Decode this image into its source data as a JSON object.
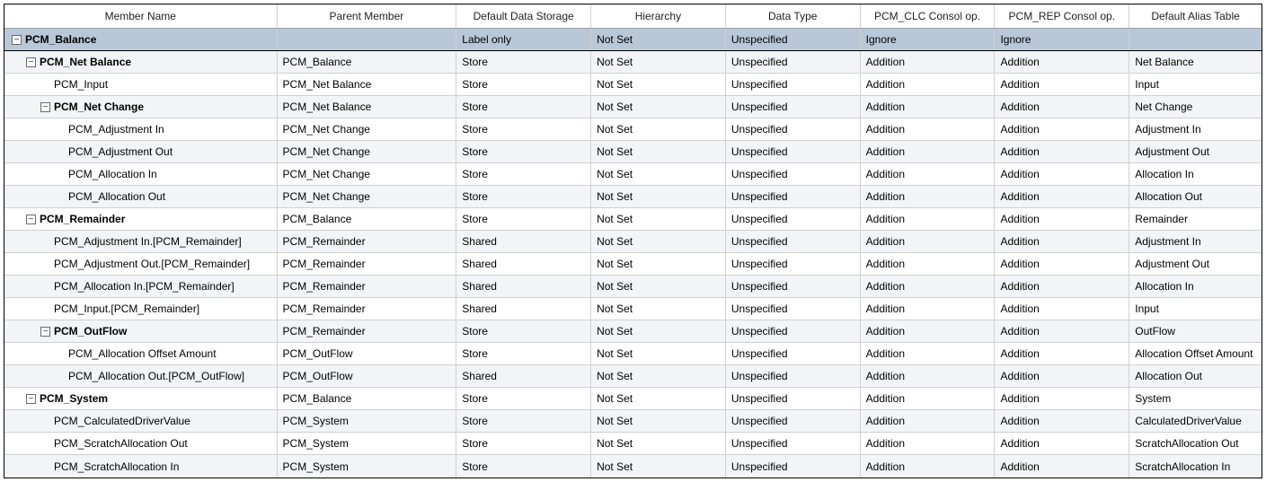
{
  "columns": [
    "Member Name",
    "Parent Member",
    "Default Data Storage",
    "Hierarchy",
    "Data Type",
    "PCM_CLC Consol op.",
    "PCM_REP Consol op.",
    "Default Alias Table"
  ],
  "rows": [
    {
      "indent": 0,
      "expander": "-",
      "bold": true,
      "selected": true,
      "member": "PCM_Balance",
      "parent": "",
      "storage": "Label only",
      "hierarchy": "Not Set",
      "datatype": "Unspecified",
      "clc": "Ignore",
      "rep": "Ignore",
      "alias": ""
    },
    {
      "indent": 1,
      "expander": "-",
      "bold": true,
      "member": "PCM_Net Balance",
      "parent": "PCM_Balance",
      "storage": "Store",
      "hierarchy": "Not Set",
      "datatype": "Unspecified",
      "clc": "Addition",
      "rep": "Addition",
      "alias": "Net Balance"
    },
    {
      "indent": 2,
      "expander": "",
      "bold": false,
      "member": "PCM_Input",
      "parent": "PCM_Net Balance",
      "storage": "Store",
      "hierarchy": "Not Set",
      "datatype": "Unspecified",
      "clc": "Addition",
      "rep": "Addition",
      "alias": "Input"
    },
    {
      "indent": 2,
      "expander": "-",
      "bold": true,
      "member": "PCM_Net Change",
      "parent": "PCM_Net Balance",
      "storage": "Store",
      "hierarchy": "Not Set",
      "datatype": "Unspecified",
      "clc": "Addition",
      "rep": "Addition",
      "alias": "Net Change"
    },
    {
      "indent": 3,
      "expander": "",
      "bold": false,
      "member": "PCM_Adjustment In",
      "parent": "PCM_Net Change",
      "storage": "Store",
      "hierarchy": "Not Set",
      "datatype": "Unspecified",
      "clc": "Addition",
      "rep": "Addition",
      "alias": "Adjustment In"
    },
    {
      "indent": 3,
      "expander": "",
      "bold": false,
      "member": "PCM_Adjustment Out",
      "parent": "PCM_Net Change",
      "storage": "Store",
      "hierarchy": "Not Set",
      "datatype": "Unspecified",
      "clc": "Addition",
      "rep": "Addition",
      "alias": "Adjustment Out"
    },
    {
      "indent": 3,
      "expander": "",
      "bold": false,
      "member": "PCM_Allocation In",
      "parent": "PCM_Net Change",
      "storage": "Store",
      "hierarchy": "Not Set",
      "datatype": "Unspecified",
      "clc": "Addition",
      "rep": "Addition",
      "alias": "Allocation In"
    },
    {
      "indent": 3,
      "expander": "",
      "bold": false,
      "member": "PCM_Allocation Out",
      "parent": "PCM_Net Change",
      "storage": "Store",
      "hierarchy": "Not Set",
      "datatype": "Unspecified",
      "clc": "Addition",
      "rep": "Addition",
      "alias": "Allocation Out"
    },
    {
      "indent": 1,
      "expander": "-",
      "bold": true,
      "member": "PCM_Remainder",
      "parent": "PCM_Balance",
      "storage": "Store",
      "hierarchy": "Not Set",
      "datatype": "Unspecified",
      "clc": "Addition",
      "rep": "Addition",
      "alias": "Remainder"
    },
    {
      "indent": 2,
      "expander": "",
      "bold": false,
      "member": "PCM_Adjustment In.[PCM_Remainder]",
      "parent": "PCM_Remainder",
      "storage": "Shared",
      "hierarchy": "Not Set",
      "datatype": "Unspecified",
      "clc": "Addition",
      "rep": "Addition",
      "alias": "Adjustment In"
    },
    {
      "indent": 2,
      "expander": "",
      "bold": false,
      "member": "PCM_Adjustment Out.[PCM_Remainder]",
      "parent": "PCM_Remainder",
      "storage": "Shared",
      "hierarchy": "Not Set",
      "datatype": "Unspecified",
      "clc": "Addition",
      "rep": "Addition",
      "alias": "Adjustment Out"
    },
    {
      "indent": 2,
      "expander": "",
      "bold": false,
      "member": "PCM_Allocation In.[PCM_Remainder]",
      "parent": "PCM_Remainder",
      "storage": "Shared",
      "hierarchy": "Not Set",
      "datatype": "Unspecified",
      "clc": "Addition",
      "rep": "Addition",
      "alias": "Allocation In"
    },
    {
      "indent": 2,
      "expander": "",
      "bold": false,
      "member": "PCM_Input.[PCM_Remainder]",
      "parent": "PCM_Remainder",
      "storage": "Shared",
      "hierarchy": "Not Set",
      "datatype": "Unspecified",
      "clc": "Addition",
      "rep": "Addition",
      "alias": "Input"
    },
    {
      "indent": 2,
      "expander": "-",
      "bold": true,
      "member": "PCM_OutFlow",
      "parent": "PCM_Remainder",
      "storage": "Store",
      "hierarchy": "Not Set",
      "datatype": "Unspecified",
      "clc": "Addition",
      "rep": "Addition",
      "alias": "OutFlow"
    },
    {
      "indent": 3,
      "expander": "",
      "bold": false,
      "member": "PCM_Allocation Offset Amount",
      "parent": "PCM_OutFlow",
      "storage": "Store",
      "hierarchy": "Not Set",
      "datatype": "Unspecified",
      "clc": "Addition",
      "rep": "Addition",
      "alias": "Allocation Offset Amount"
    },
    {
      "indent": 3,
      "expander": "",
      "bold": false,
      "member": "PCM_Allocation Out.[PCM_OutFlow]",
      "parent": "PCM_OutFlow",
      "storage": "Shared",
      "hierarchy": "Not Set",
      "datatype": "Unspecified",
      "clc": "Addition",
      "rep": "Addition",
      "alias": "Allocation Out"
    },
    {
      "indent": 1,
      "expander": "-",
      "bold": true,
      "member": "PCM_System",
      "parent": "PCM_Balance",
      "storage": "Store",
      "hierarchy": "Not Set",
      "datatype": "Unspecified",
      "clc": "Addition",
      "rep": "Addition",
      "alias": "System"
    },
    {
      "indent": 2,
      "expander": "",
      "bold": false,
      "member": "PCM_CalculatedDriverValue",
      "parent": "PCM_System",
      "storage": "Store",
      "hierarchy": "Not Set",
      "datatype": "Unspecified",
      "clc": "Addition",
      "rep": "Addition",
      "alias": "CalculatedDriverValue"
    },
    {
      "indent": 2,
      "expander": "",
      "bold": false,
      "member": "PCM_ScratchAllocation Out",
      "parent": "PCM_System",
      "storage": "Store",
      "hierarchy": "Not Set",
      "datatype": "Unspecified",
      "clc": "Addition",
      "rep": "Addition",
      "alias": "ScratchAllocation Out"
    },
    {
      "indent": 2,
      "expander": "",
      "bold": false,
      "member": "PCM_ScratchAllocation In",
      "parent": "PCM_System",
      "storage": "Store",
      "hierarchy": "Not Set",
      "datatype": "Unspecified",
      "clc": "Addition",
      "rep": "Addition",
      "alias": "ScratchAllocation In"
    }
  ]
}
